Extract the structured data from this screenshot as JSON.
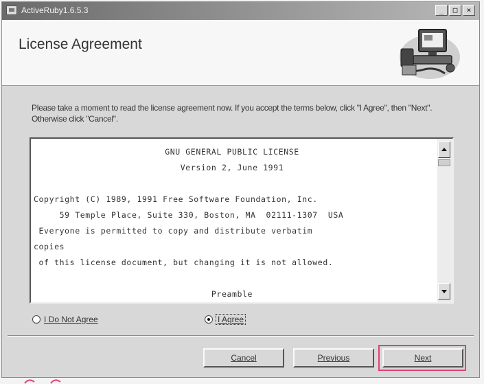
{
  "window": {
    "title": "ActiveRuby1.6.5.3",
    "controls": [
      "_",
      "□",
      "×"
    ]
  },
  "header": {
    "title": "License Agreement",
    "graphic_icon": "computer-setup-icon"
  },
  "instruction": "Please take a moment to read the license agreement now. If you accept the terms below, click \"I Agree\", then \"Next\". Otherwise click \"Cancel\".",
  "license": {
    "lines": [
      {
        "text": "GNU GENERAL PUBLIC LICENSE",
        "center": true
      },
      {
        "text": "Version 2, June 1991",
        "center": true
      },
      {
        "text": "",
        "center": false
      },
      {
        "text": "Copyright (C) 1989, 1991 Free Software Foundation, Inc.",
        "center": false
      },
      {
        "text": "     59 Temple Place, Suite 330, Boston, MA  02111-1307  USA",
        "center": false
      },
      {
        "text": " Everyone is permitted to copy and distribute verbatim",
        "center": false
      },
      {
        "text": "copies",
        "center": false
      },
      {
        "text": " of this license document, but changing it is not allowed.",
        "center": false
      },
      {
        "text": "",
        "center": false
      },
      {
        "text": "Preamble",
        "center": true
      }
    ]
  },
  "options": {
    "disagree_label": "I Do Not Agree",
    "agree_label": "I Agree",
    "selected": "agree"
  },
  "buttons": {
    "cancel": "Cancel",
    "previous": "Previous",
    "next": "Next"
  },
  "colors": {
    "highlight": "#e0407a"
  }
}
